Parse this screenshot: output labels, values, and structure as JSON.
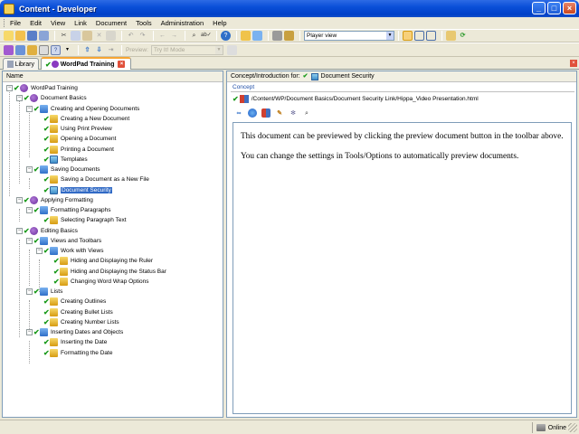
{
  "window": {
    "title": "Content - Developer"
  },
  "menu": [
    "File",
    "Edit",
    "View",
    "Link",
    "Document",
    "Tools",
    "Administration",
    "Help"
  ],
  "toolbar": {
    "player_view_select": "Player view",
    "preview_label": "Preview:",
    "mode_select": "Try It! Mode"
  },
  "tabs": {
    "library": "Library",
    "course": "WordPad Training"
  },
  "left_pane": {
    "header": "Name",
    "tree": [
      {
        "label": "WordPad Training",
        "type": "course"
      },
      {
        "label": "Document Basics",
        "type": "course"
      },
      {
        "label": "Creating and Opening Documents",
        "type": "module"
      },
      {
        "label": "Creating a New Document",
        "type": "topic"
      },
      {
        "label": "Using Print Preview",
        "type": "topic"
      },
      {
        "label": "Opening a Document",
        "type": "topic"
      },
      {
        "label": "Printing a Document",
        "type": "topic"
      },
      {
        "label": "Templates",
        "type": "topic2"
      },
      {
        "label": "Saving Documents",
        "type": "module"
      },
      {
        "label": "Saving a Document as a New File",
        "type": "topic"
      },
      {
        "label": "Document Security",
        "type": "topic2"
      },
      {
        "label": "Applying Formatting",
        "type": "course"
      },
      {
        "label": "Formatting Paragraphs",
        "type": "module"
      },
      {
        "label": "Selecting Paragraph Text",
        "type": "topic"
      },
      {
        "label": "Editing Basics",
        "type": "course"
      },
      {
        "label": "Views and Toolbars",
        "type": "module"
      },
      {
        "label": "Work with Views",
        "type": "module"
      },
      {
        "label": "Hiding and Displaying the Ruler",
        "type": "topic"
      },
      {
        "label": "Hiding and Displaying the Status Bar",
        "type": "topic"
      },
      {
        "label": "Changing Word Wrap Options",
        "type": "topic"
      },
      {
        "label": "Lists",
        "type": "module"
      },
      {
        "label": "Creating Outlines",
        "type": "topic"
      },
      {
        "label": "Creating Bullet Lists",
        "type": "topic"
      },
      {
        "label": "Creating Number Lists",
        "type": "topic"
      },
      {
        "label": "Inserting Dates and Objects",
        "type": "module"
      },
      {
        "label": "Inserting the Date",
        "type": "topic"
      },
      {
        "label": "Formatting the Date",
        "type": "topic"
      }
    ]
  },
  "right_pane": {
    "header_prefix": "Concept/Introduction for:",
    "header_topic": "Document Security",
    "section_label": "Concept",
    "path": "/Content/WP/Document Basics/Document Security Link/Hippa_Video Presentation.html",
    "paragraph1": "This document can be previewed by clicking the preview document button in the toolbar above.",
    "paragraph2": "You can change the settings in Tools/Options to automatically preview documents."
  },
  "status": {
    "online": "Online"
  },
  "colors": {
    "title_bar": "#0a4fd8",
    "selection": "#316ac5",
    "check_green": "#1a9a1a",
    "chrome": "#ece9d8"
  }
}
